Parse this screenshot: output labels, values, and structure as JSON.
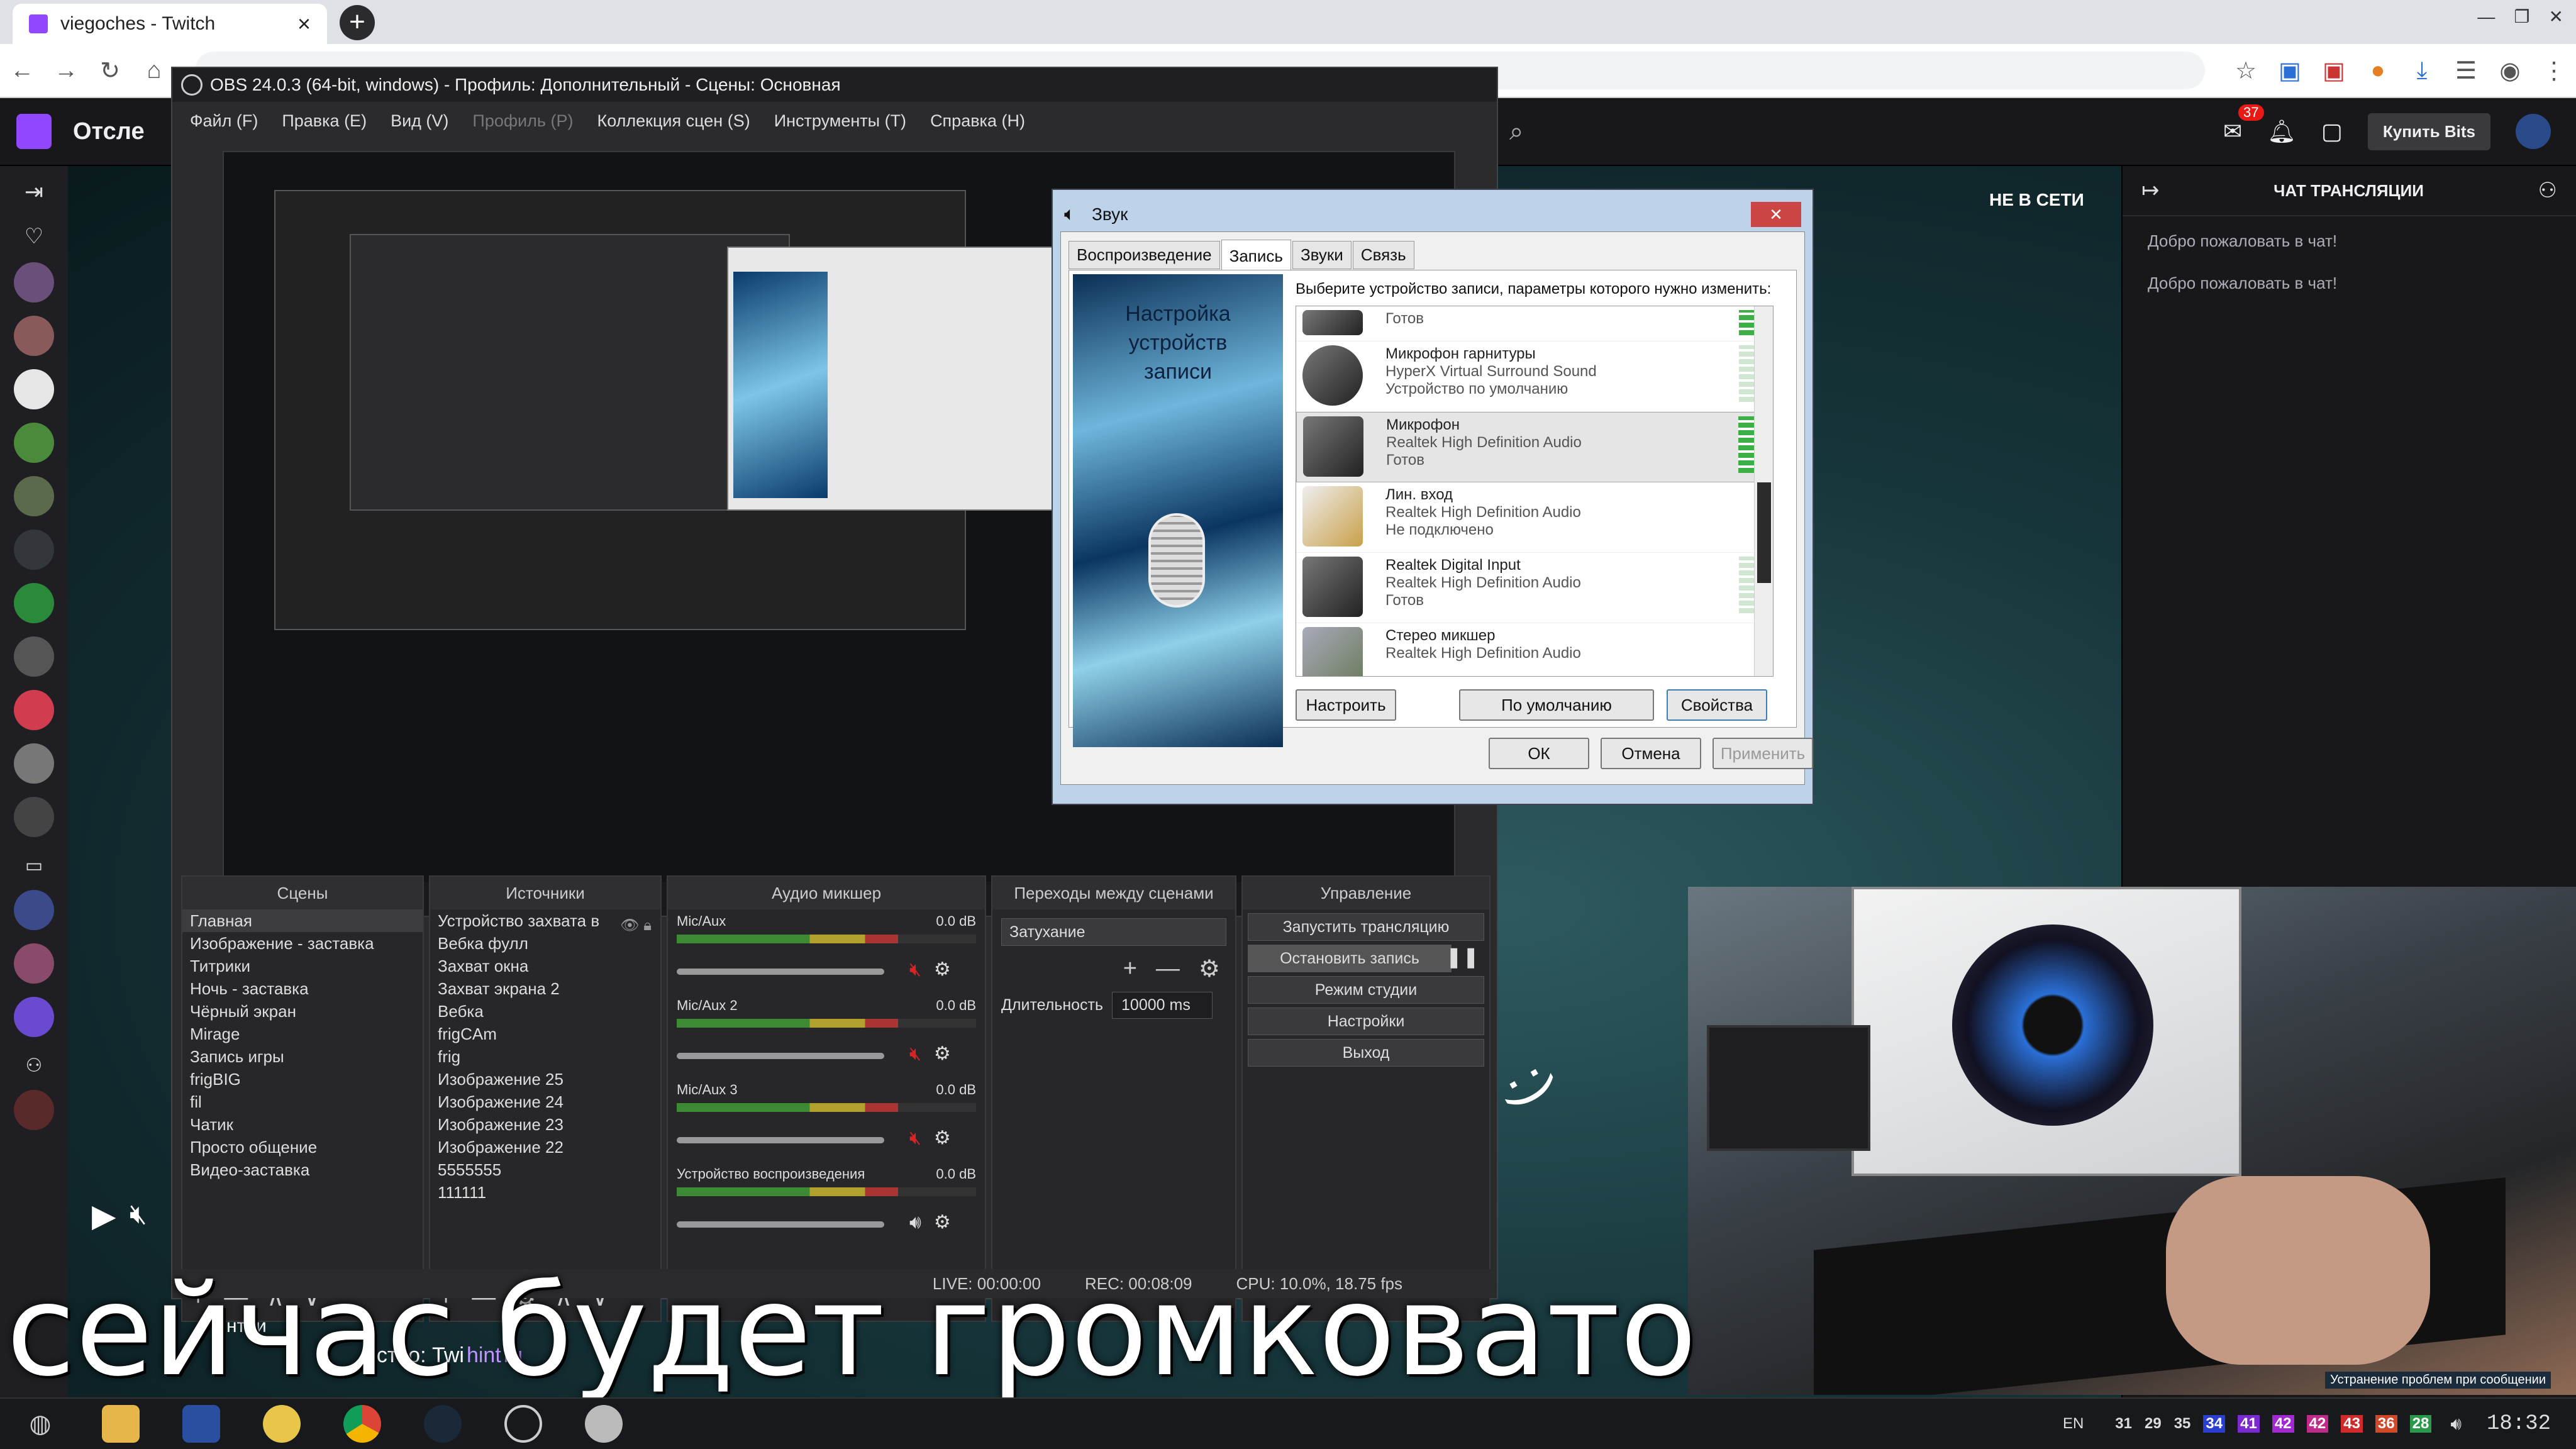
{
  "browser": {
    "tab_title": "viegoches - Twitch",
    "tab_close": "×",
    "new_tab": "+"
  },
  "twitch": {
    "header_left": "Отсле",
    "notif_count": "37",
    "buy_bits": "Купить Bits",
    "offline_badge": "НЕ В СЕТИ",
    "chat_title": "ЧАТ ТРАНСЛЯЦИИ",
    "chat_messages": [
      "Добро пожаловать в чат!",
      "Добро пожаловать в чат!"
    ],
    "community_text": "ество: Twi",
    "community_suffix": "hint",
    "community_end": "ru",
    "channel_fragment": "viegoches",
    "about_fragment": "нтри"
  },
  "obs": {
    "title": "OBS 24.0.3 (64-bit, windows) - Профиль: Дополнительный - Сцены: Основная",
    "menu": [
      "Файл (F)",
      "Правка (E)",
      "Вид (V)",
      "Профиль (P)",
      "Коллекция сцен (S)",
      "Инструменты (T)",
      "Справка (H)"
    ],
    "docks": {
      "scenes": "Сцены",
      "sources": "Источники",
      "mixer": "Аудио микшер",
      "transitions": "Переходы между сценами",
      "controls": "Управление"
    },
    "scenes": [
      "Главная",
      "Изображение - заставка",
      "Титрики",
      "Ночь - заставка",
      "Чёрный экран",
      "Mirage",
      "Запись игры",
      "frigBIG",
      "fil",
      "Чатик",
      "Просто общение",
      "Видео-заставка"
    ],
    "sources": [
      "Устройство захвата в",
      "Вебка фулл",
      "Захват окна",
      "Захват экрана 2",
      "Вебка",
      "frigCAm",
      "frig",
      "Изображение 25",
      "Изображение 24",
      "Изображение 23",
      "Изображение 22",
      "5555555",
      "111111"
    ],
    "mixer": [
      {
        "name": "Mic/Aux",
        "db": "0.0 dB",
        "level": 0.74
      },
      {
        "name": "Mic/Aux 2",
        "db": "0.0 dB",
        "level": 0.74
      },
      {
        "name": "Mic/Aux 3",
        "db": "0.0 dB",
        "level": 0.74
      },
      {
        "name": "Устройство воспроизведения",
        "db": "0.0 dB",
        "level": 0.74
      }
    ],
    "transition": "Затухание",
    "duration_label": "Длительность",
    "duration_value": "10000 ms",
    "controls": [
      "Запустить трансляцию",
      "Остановить запись",
      "Режим студии",
      "Настройки",
      "Выход"
    ],
    "status": {
      "live": "LIVE: 00:00:00",
      "rec": "REC: 00:08:09",
      "cpu": "CPU: 10.0%, 18.75 fps"
    }
  },
  "sound": {
    "title": "Звук",
    "tabs": [
      "Воспроизведение",
      "Запись",
      "Звуки",
      "Связь"
    ],
    "active_tab": "Запись",
    "banner": "Настройка устройств записи",
    "instruction": "Выберите устройство записи, параметры которого нужно изменить:",
    "devices": [
      {
        "name": "",
        "driver": "",
        "status": "Готов"
      },
      {
        "name": "Микрофон гарнитуры",
        "driver": "HyperX Virtual Surround Sound",
        "status": "Устройство по умолчанию"
      },
      {
        "name": "Микрофон",
        "driver": "Realtek High Definition Audio",
        "status": "Готов"
      },
      {
        "name": "Лин. вход",
        "driver": "Realtek High Definition Audio",
        "status": "Не подключено"
      },
      {
        "name": "Realtek Digital Input",
        "driver": "Realtek High Definition Audio",
        "status": "Готов"
      },
      {
        "name": "Стерео микшер",
        "driver": "Realtek High Definition Audio",
        "status": ""
      }
    ],
    "btn_configure": "Настроить",
    "btn_default": "По умолчанию",
    "btn_props": "Свойства",
    "btn_ok": "ОК",
    "btn_cancel": "Отмена",
    "btn_apply": "Применить"
  },
  "caption": "сейчас будет громковато",
  "taskbar": {
    "lang": "EN",
    "tray_numbers": [
      "31",
      "29",
      "35",
      "34",
      "41",
      "42",
      "42",
      "43",
      "36",
      "28"
    ],
    "clock": "18:32"
  },
  "webcam_overlay": "Устранение проблем при сообщении"
}
